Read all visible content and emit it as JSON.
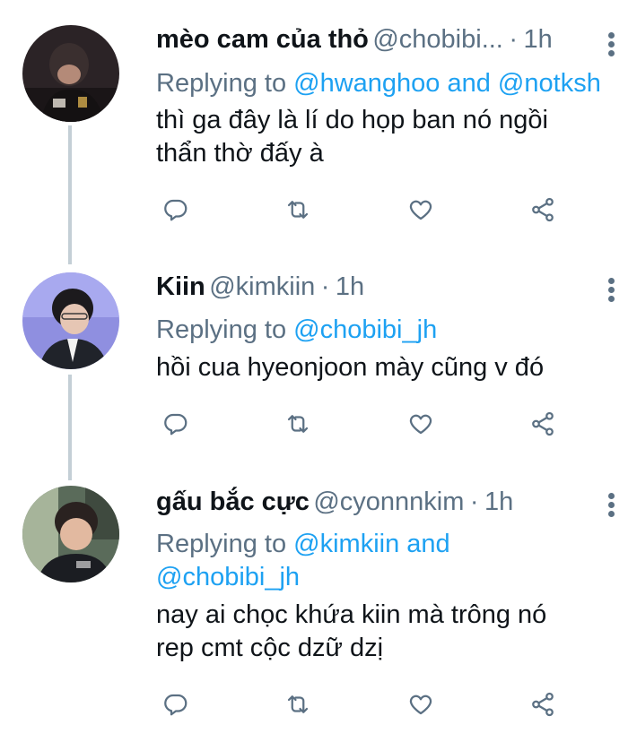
{
  "tweets": [
    {
      "name": "mèo cam của thỏ",
      "handle": "@chobibi...",
      "dot": "·",
      "time": "1h",
      "replying_label": "Replying to ",
      "reply_line1": "@hwanghoo and @notksh",
      "reply_line2": "",
      "text_lines": [
        "thì ga đây là lí do họp ban nó ngồi",
        "thẩn thờ đấy à"
      ]
    },
    {
      "name": "Kiin",
      "handle": "@kimkiin",
      "dot": "·",
      "time": "1h",
      "replying_label": "Replying to ",
      "reply_line1": "@chobibi_jh",
      "reply_line2": "",
      "text_lines": [
        "hồi cua hyeonjoon mày cũng v đó",
        ""
      ]
    },
    {
      "name": "gấu bắc cực",
      "handle": "@cyonnnkim",
      "dot": "·",
      "time": "1h",
      "replying_label": "Replying to ",
      "reply_line1": "@kimkiin and",
      "reply_line2": "@chobibi_jh",
      "text_lines": [
        "nay ai chọc khứa kiin mà trông nó",
        "rep cmt cộc dzữ dzị"
      ]
    }
  ],
  "icons": {
    "reply": "reply-icon",
    "retweet": "retweet-icon",
    "like": "heart-icon",
    "share": "share-icon",
    "more": "more-vertical-icon"
  },
  "colors": {
    "secondary": "#5b7083",
    "link": "#1da1f2",
    "thread_line": "#c4cfd6"
  }
}
